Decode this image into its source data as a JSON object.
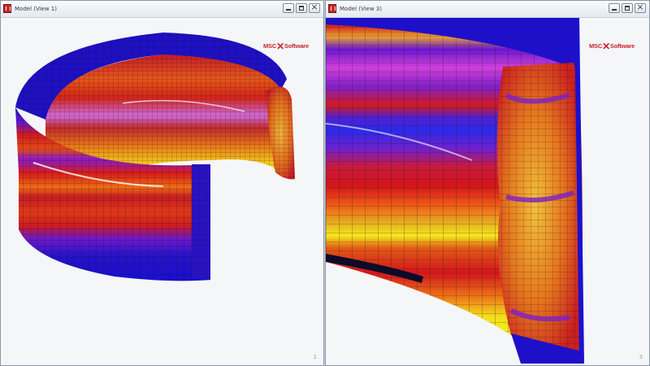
{
  "windows": [
    {
      "title": "Model (View 1)",
      "logo": {
        "left": "MSC",
        "mark": "✕",
        "right": "Software"
      },
      "corner_number": "1",
      "viewport_bg": "#f5f6f8"
    },
    {
      "title": "Model (View 3)",
      "logo": {
        "left": "MSC",
        "mark": "✕",
        "right": "Software"
      },
      "corner_number": "3",
      "viewport_bg": "#f5f6f8"
    }
  ],
  "colors": {
    "accent_brand": "#c8262a",
    "mesh_blue": "#1a0fd0",
    "mesh_purple": "#7a1fd0",
    "mesh_red": "#d2161b",
    "mesh_orange": "#e85a14",
    "mesh_yellow": "#f2e21a"
  },
  "icons": {
    "app": "app-icon",
    "minimize": "minimize-icon",
    "maximize": "maximize-icon",
    "close": "close-icon"
  }
}
